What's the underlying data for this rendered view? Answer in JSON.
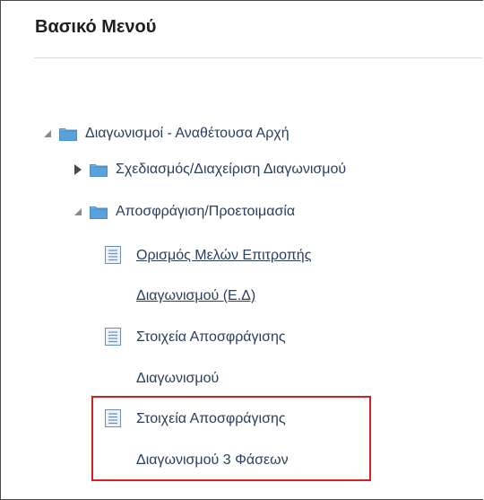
{
  "panel": {
    "title": "Βασικό Μενού"
  },
  "tree": {
    "root": {
      "label": "Διαγωνισμοί - Αναθέτουσα Αρχή",
      "toggle_icon": "triangle-down-icon",
      "folder_icon": "folder-icon"
    },
    "planning": {
      "label": "Σχεδιασμός/Διαχείριση Διαγωνισμού",
      "toggle_icon": "triangle-right-icon",
      "folder_icon": "folder-icon"
    },
    "unsealing": {
      "label": "Αποσφράγιση/Προετοιμασία",
      "toggle_icon": "triangle-down-icon",
      "folder_icon": "folder-icon"
    },
    "items": [
      {
        "line1": "Ορισμός Μελών Επιτροπής",
        "line2": "Διαγωνισμού (Ε.Δ)",
        "icon": "page-icon",
        "is_link": true
      },
      {
        "line1": "Στοιχεία Αποσφράγισης",
        "line2": "Διαγωνισμού",
        "icon": "page-icon",
        "is_link": false
      },
      {
        "line1": "Στοιχεία Αποσφράγισης",
        "line2": "Διαγωνισμού 3 Φάσεων",
        "icon": "page-icon",
        "is_link": false,
        "highlighted": true
      }
    ]
  },
  "colors": {
    "highlight": "#d42020",
    "folder": "#5aa2d9",
    "link": "#1b3f73",
    "text": "#2a3e5e"
  }
}
